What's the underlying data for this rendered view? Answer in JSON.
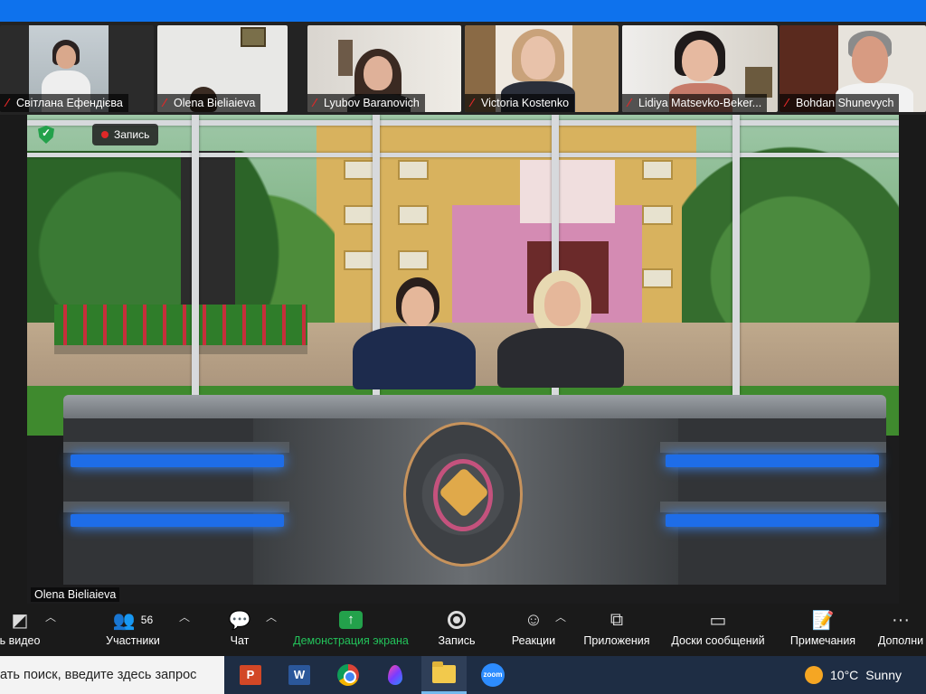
{
  "participants": [
    {
      "name": "Світлана Ефендієва"
    },
    {
      "name": "Olena Bieliaieva"
    },
    {
      "name": "Lyubov Baranovich"
    },
    {
      "name": "Victoria Kostenko"
    },
    {
      "name": "Lidiya Matsevko-Beker..."
    },
    {
      "name": "Bohdan Shunevych"
    }
  ],
  "main_video": {
    "recording_label": "Запись",
    "speaker_name": "Olena Bieliaieva"
  },
  "toolbar": {
    "video_label": "ь видео",
    "participants_label": "Участники",
    "participants_count": "56",
    "chat_label": "Чат",
    "share_label": "Демонстрация экрана",
    "record_label": "Запись",
    "reactions_label": "Реакции",
    "apps_label": "Приложения",
    "whiteboards_label": "Доски сообщений",
    "notes_label": "Примечания",
    "more_label": "Дополни"
  },
  "taskbar": {
    "search_text": "ать поиск, введите здесь запрос",
    "weather_temp": "10°C",
    "weather_desc": "Sunny",
    "apps": [
      "powerpoint-icon",
      "word-icon",
      "chrome-icon",
      "paint-drop-icon",
      "file-explorer-icon",
      "zoom-icon"
    ]
  },
  "colors": {
    "zoom_blue": "#0e72ed",
    "share_green": "#23a14b",
    "mute_red": "#e02828",
    "desk_light_blue": "#1e6de8"
  }
}
